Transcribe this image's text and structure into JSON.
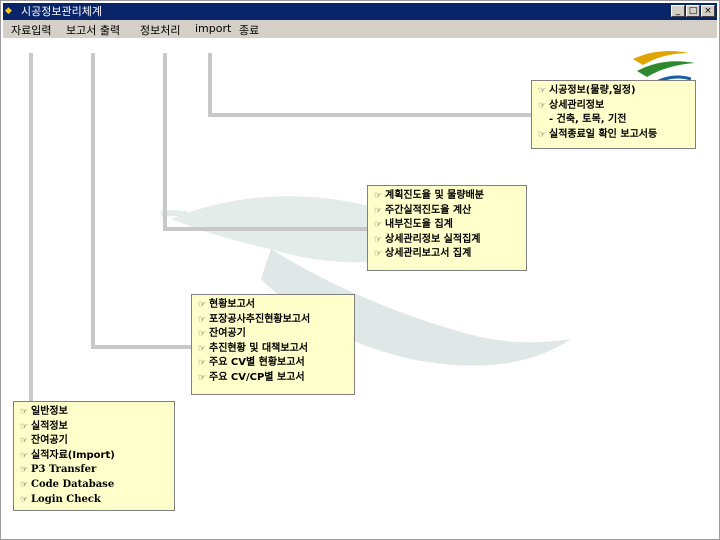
{
  "window": {
    "title": "시공정보관리체계",
    "app_icon": "app-icon"
  },
  "title_buttons": {
    "minimize": "_",
    "maximize": "□",
    "close": "×"
  },
  "menu": [
    {
      "label": "자료입력"
    },
    {
      "label": "보고서 출력"
    },
    {
      "label": "정보처리"
    },
    {
      "label": "import"
    },
    {
      "label": "종료"
    }
  ],
  "boxes": {
    "import": [
      "시공정보(물량,일정)",
      "상세관리정보",
      "- 건축, 토목, 기전",
      "실적종료일 확인 보고서등"
    ],
    "processing": [
      "계획진도율 및 물량배분",
      "주간실적진도율 계산",
      "내부진도율 집계",
      "상세관리정보 실적집계",
      "상세관리보고서 집계"
    ],
    "reports": [
      "현황보고서",
      "포장공사추진현황보고서",
      "잔여공기",
      "추진현황 및 대책보고서",
      "주요 CV별 현황보고서",
      "주요 CV/CP별 보고서"
    ],
    "input": [
      "일반정보",
      "실적정보",
      "잔여공기",
      "실적자료(Import)",
      "P3 Transfer",
      "Code Database",
      "Login Check"
    ]
  },
  "colors": {
    "titlebar": "#0a246a",
    "menubar": "#d4d0c8",
    "box_fill": "#ffffcc",
    "connector": "#c8c8c8"
  },
  "icons": {
    "bullet": "hand-pointer-icon",
    "logo": "logo-swoosh-icon",
    "background": "crane-bird-watermark"
  }
}
